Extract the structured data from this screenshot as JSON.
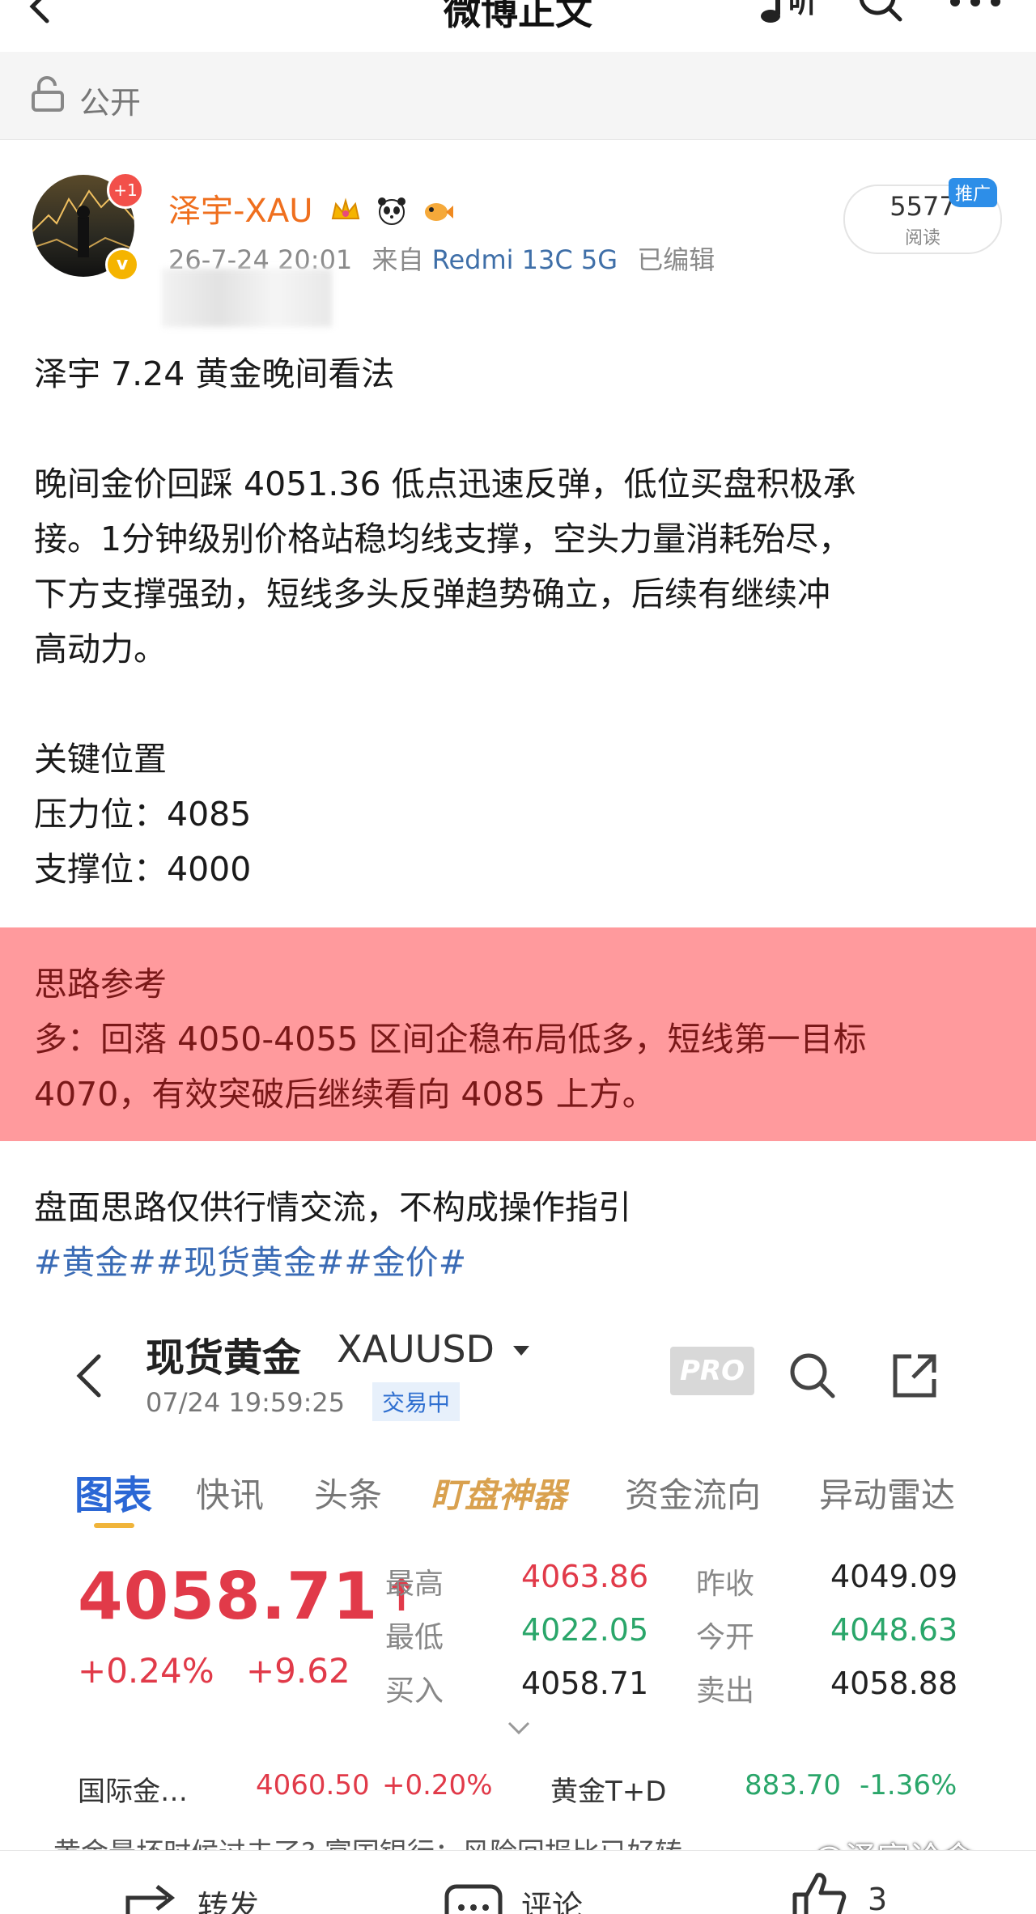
{
  "header": {
    "title": "微博正文",
    "listen_label": "听"
  },
  "visibility": {
    "label": "公开"
  },
  "post": {
    "author": "泽宇-XAU",
    "plus_badge": "+1",
    "verified_mark": "v",
    "time": "26-7-24 20:01",
    "from_label": "来自",
    "device": "Redmi 13C 5G",
    "edited_label": "已编辑",
    "reads": "5577",
    "reads_label": "阅读",
    "promo_label": "推广",
    "lines": [
      "泽宇 7.24 黄金晚间看法",
      "晚间金价回踩 4051.36 低点迅速反弹，低位买盘积极承",
      "接。1分钟级别价格站稳均线支撑，空头力量消耗殆尽，",
      "下方支撑强劲，短线多头反弹趋势确立，后续有继续冲",
      "高动力。",
      "关键位置",
      "压力位：4085",
      "支撑位：4000"
    ],
    "highlight_lines": [
      "思路参考",
      "多：回落 4050-4055 区间企稳布局低多，短线第一目标",
      "4070，有效突破后继续看向 4085 上方。"
    ],
    "disclaimer": "盘面思路仅供行情交流，不构成操作指引",
    "hashtags": "#黄金##现货黄金##金价#"
  },
  "embedded": {
    "title": "现货黄金",
    "symbol": "XAUUSD",
    "time": "07/24 19:59:25",
    "status": "交易中",
    "pro": "PRO",
    "tabs": [
      "图表",
      "快讯",
      "头条",
      "盯盘神器",
      "资金流向",
      "异动雷达"
    ],
    "price": "4058.71",
    "price_arrow": "↑",
    "change_pct": "+0.24%",
    "change_abs": "+9.62",
    "stats": {
      "high_label": "最高",
      "high": "4063.86",
      "prev_close_label": "昨收",
      "prev_close": "4049.09",
      "low_label": "最低",
      "low": "4022.05",
      "open_label": "今开",
      "open": "4048.63",
      "bid_label": "买入",
      "bid": "4058.71",
      "ask_label": "卖出",
      "ask": "4058.88"
    },
    "intl_label": "国际金…",
    "intl_price": "4060.50",
    "intl_change": "+0.20%",
    "td_label": "黄金T+D",
    "td_price": "883.70",
    "td_change": "-1.36%",
    "news_snippet": "黄金最坏时候过去了? 富国银行：风险回报比已好转"
  },
  "watermark": "@泽宇论金",
  "bottom_bar": {
    "repost": "转发",
    "comment": "评论",
    "like_count": "3"
  },
  "colors": {
    "accent": "#ef6f1e",
    "link": "#3a6bb5",
    "highlight_bg": "#ff9a9d",
    "up": "#e13a49",
    "down": "#2aa66a"
  }
}
